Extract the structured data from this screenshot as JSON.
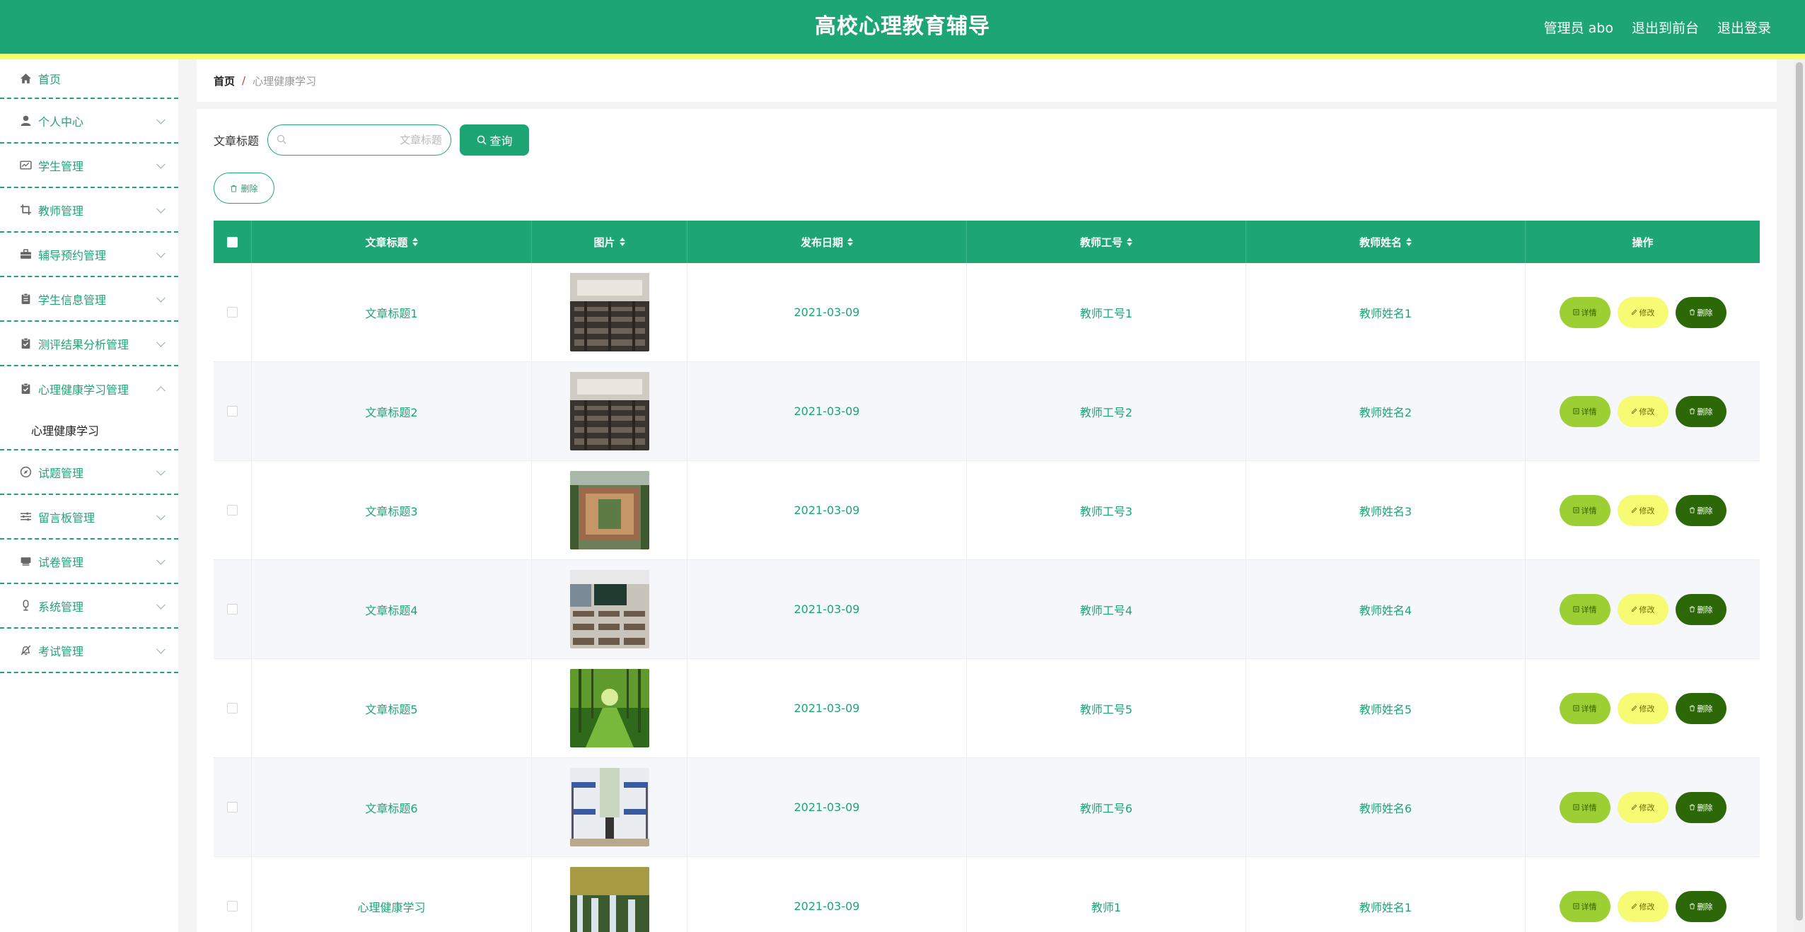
{
  "header": {
    "title": "高校心理教育辅导",
    "user_label": "管理员 abo",
    "back_link": "退出到前台",
    "logout_link": "退出登录"
  },
  "sidebar": {
    "items": [
      {
        "label": "首页",
        "icon": "home-icon"
      },
      {
        "label": "个人中心",
        "icon": "person-icon"
      },
      {
        "label": "学生管理",
        "icon": "id-card-icon"
      },
      {
        "label": "教师管理",
        "icon": "crop-icon"
      },
      {
        "label": "辅导预约管理",
        "icon": "briefcase-icon"
      },
      {
        "label": "学生信息管理",
        "icon": "clipboard-icon"
      },
      {
        "label": "测评结果分析管理",
        "icon": "clipboard-check-icon"
      },
      {
        "label": "心理健康学习管理",
        "icon": "clipboard-check-icon"
      },
      {
        "label": "试题管理",
        "icon": "compass-icon"
      },
      {
        "label": "留言板管理",
        "icon": "sliders-icon"
      },
      {
        "label": "试卷管理",
        "icon": "printer-icon"
      },
      {
        "label": "系统管理",
        "icon": "microphone-icon"
      },
      {
        "label": "考试管理",
        "icon": "bell-off-icon"
      }
    ],
    "submenu_label": "心理健康学习"
  },
  "breadcrumb": {
    "home": "首页",
    "separator": "/",
    "current": "心理健康学习"
  },
  "search": {
    "label": "文章标题",
    "placeholder": "文章标题",
    "value": "",
    "button_label": "查询"
  },
  "toolbar": {
    "delete_label": "删除"
  },
  "table": {
    "columns": [
      "文章标题",
      "图片",
      "发布日期",
      "教师工号",
      "教师姓名",
      "操作"
    ],
    "rows": [
      {
        "title": "文章标题1",
        "date": "2021-03-09",
        "teacher_no": "教师工号1",
        "teacher_name": "教师姓名1",
        "image": "auditorium-photo"
      },
      {
        "title": "文章标题2",
        "date": "2021-03-09",
        "teacher_no": "教师工号2",
        "teacher_name": "教师姓名2",
        "image": "auditorium-photo"
      },
      {
        "title": "文章标题3",
        "date": "2021-03-09",
        "teacher_no": "教师工号3",
        "teacher_name": "教师姓名3",
        "image": "campus-aerial-photo"
      },
      {
        "title": "文章标题4",
        "date": "2021-03-09",
        "teacher_no": "教师工号4",
        "teacher_name": "教师姓名4",
        "image": "classroom-photo"
      },
      {
        "title": "文章标题5",
        "date": "2021-03-09",
        "teacher_no": "教师工号5",
        "teacher_name": "教师姓名5",
        "image": "forest-path-photo"
      },
      {
        "title": "文章标题6",
        "date": "2021-03-09",
        "teacher_no": "教师工号6",
        "teacher_name": "教师姓名6",
        "image": "dormitory-photo"
      },
      {
        "title": "心理健康学习",
        "date": "2021-03-09",
        "teacher_no": "教师1",
        "teacher_name": "教师姓名1",
        "image": "waterfall-photo"
      }
    ],
    "actions": {
      "detail": "详情",
      "edit": "修改",
      "remove": "删除"
    }
  },
  "colors": {
    "primary": "#1ea574",
    "accent_strip": "#f3ff6c",
    "detail_button": "#9ccf33",
    "edit_button": "#f6fb73",
    "remove_button": "#2d6808"
  }
}
